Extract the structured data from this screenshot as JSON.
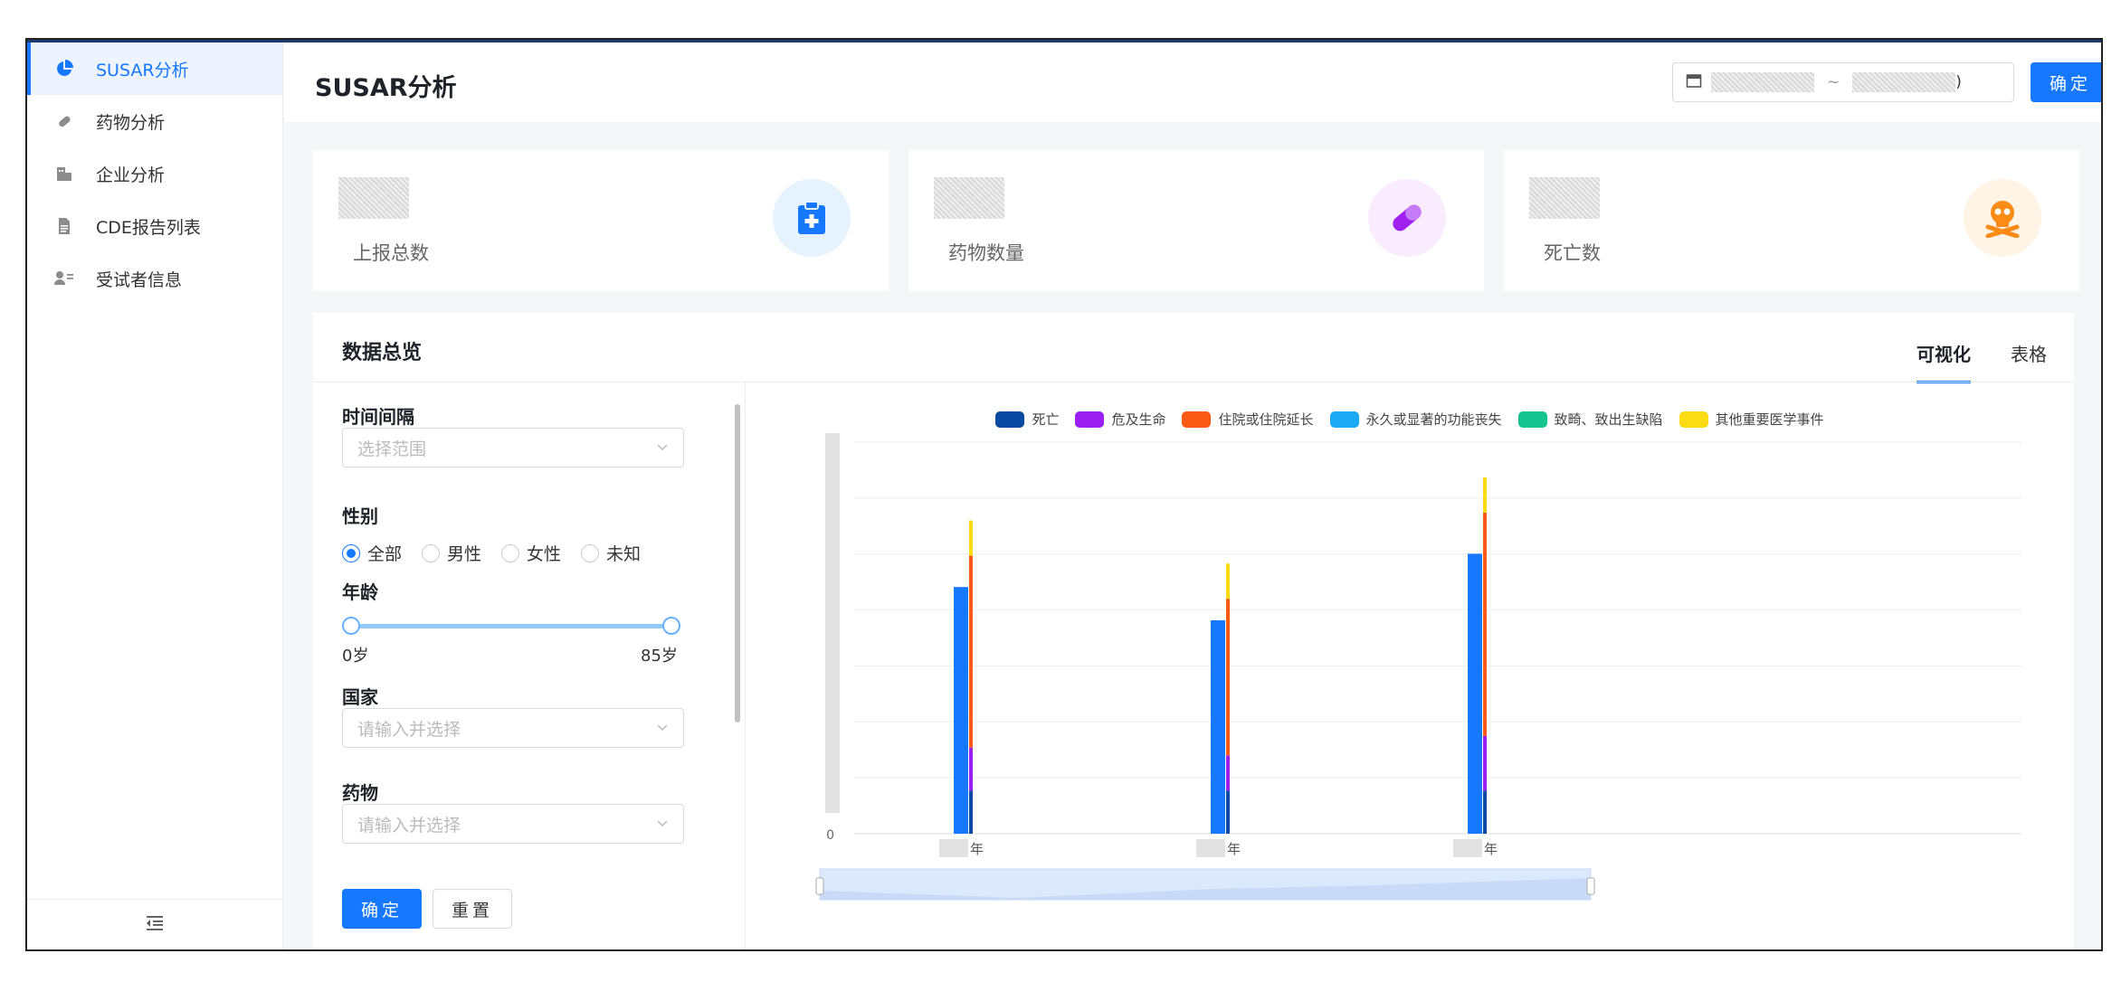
{
  "sidebar": {
    "items": [
      {
        "label": "SUSAR分析",
        "icon": "pie-chart-icon",
        "active": true
      },
      {
        "label": "药物分析",
        "icon": "pill-icon",
        "active": false
      },
      {
        "label": "企业分析",
        "icon": "building-icon",
        "active": false
      },
      {
        "label": "CDE报告列表",
        "icon": "document-icon",
        "active": false
      },
      {
        "label": "受试者信息",
        "icon": "contact-card-icon",
        "active": false
      }
    ],
    "collapse_icon": "menu-fold-icon"
  },
  "header": {
    "title": "SUSAR分析",
    "date_separator": "~",
    "date_end_suffix": ")",
    "confirm_label": "确定"
  },
  "stats": [
    {
      "label": "上报总数",
      "icon": "medical-clipboard-icon",
      "color": "#1677ff"
    },
    {
      "label": "药物数量",
      "icon": "capsule-icon",
      "color": "#a020f0"
    },
    {
      "label": "死亡数",
      "icon": "skull-crossbones-icon",
      "color": "#fa8c16"
    }
  ],
  "overview": {
    "title": "数据总览",
    "tabs": [
      {
        "label": "可视化",
        "active": true
      },
      {
        "label": "表格",
        "active": false
      }
    ],
    "filters": {
      "interval_label": "时间间隔",
      "interval_placeholder": "选择范围",
      "gender_label": "性别",
      "gender_options": [
        {
          "label": "全部",
          "checked": true
        },
        {
          "label": "男性",
          "checked": false
        },
        {
          "label": "女性",
          "checked": false
        },
        {
          "label": "未知",
          "checked": false
        }
      ],
      "age_label": "年龄",
      "age_min": "0岁",
      "age_max": "85岁",
      "country_label": "国家",
      "country_placeholder": "请输入并选择",
      "drug_label": "药物",
      "drug_placeholder": "请输入并选择",
      "confirm_label": "确定",
      "reset_label": "重置"
    }
  },
  "chart_data": {
    "type": "bar",
    "legend": [
      {
        "name": "死亡",
        "color": "#0b4aa2"
      },
      {
        "name": "危及生命",
        "color": "#9b1ff0"
      },
      {
        "name": "住院或住院延长",
        "color": "#fa5a14"
      },
      {
        "name": "永久或显著的功能丧失",
        "color": "#1aaaf5"
      },
      {
        "name": "致畸、致出生缺陷",
        "color": "#14c38e"
      },
      {
        "name": "其他重要医学事件",
        "color": "#fadb14"
      }
    ],
    "total_color": "#1677ff",
    "y_tick_zero": "0",
    "x_suffix": "年",
    "ylim": [
      0,
      1
    ],
    "groups": [
      {
        "total": 0.63,
        "stack": {
          "死亡": 0.11,
          "危及生命": 0.11,
          "住院或住院延长": 0.49,
          "其他重要医学事件": 0.09
        }
      },
      {
        "total": 0.545,
        "stack": {
          "死亡": 0.11,
          "危及生命": 0.09,
          "住院或住院延长": 0.4,
          "其他重要医学事件": 0.09
        }
      },
      {
        "total": 0.715,
        "stack": {
          "死亡": 0.11,
          "危及生命": 0.14,
          "住院或住院延长": 0.57,
          "其他重要医学事件": 0.09
        }
      }
    ]
  }
}
